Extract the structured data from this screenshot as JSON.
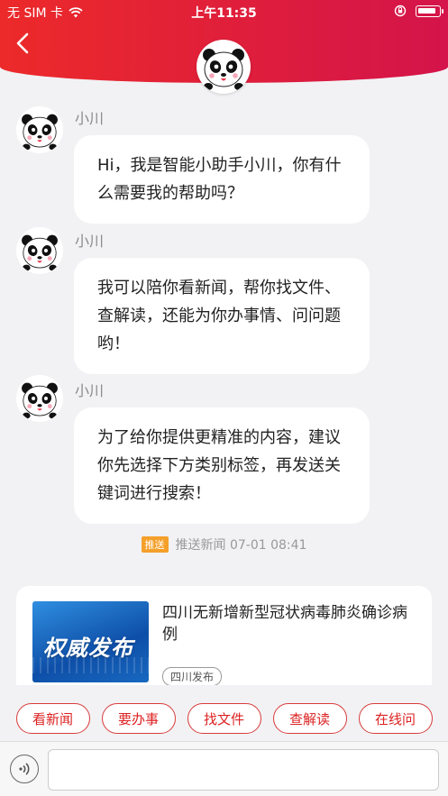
{
  "status_bar": {
    "carrier": "无 SIM 卡",
    "time": "上午11:35",
    "battery_level": 0.85
  },
  "header": {
    "back_icon": "chevron-left-icon",
    "avatar_icon": "panda-avatar-icon"
  },
  "messages": [
    {
      "name": "小川",
      "text": "Hi，我是智能小助手小川，你有什么需要我的帮助吗？"
    },
    {
      "name": "小川",
      "text": "我可以陪你看新闻，帮你找文件、查解读，还能为你办事情、问问题哟！"
    },
    {
      "name": "小川",
      "text": "为了给你提供更精准的内容，建议你先选择下方类别标签，再发送关键词进行搜索！"
    }
  ],
  "push": {
    "tag": "推送",
    "text": "推送新闻 07-01 08:41"
  },
  "news": {
    "thumb_text": "权威发布",
    "title": "四川无新增新型冠状病毒肺炎确诊病例",
    "source": "四川发布"
  },
  "quick_actions": [
    "看新闻",
    "要办事",
    "找文件",
    "查解读",
    "在线问"
  ],
  "input": {
    "placeholder": "",
    "voice_icon": "voice-icon"
  },
  "colors": {
    "brand": "#e02435",
    "chip_border": "#d93a3a",
    "push_tag": "#f4a02a"
  }
}
